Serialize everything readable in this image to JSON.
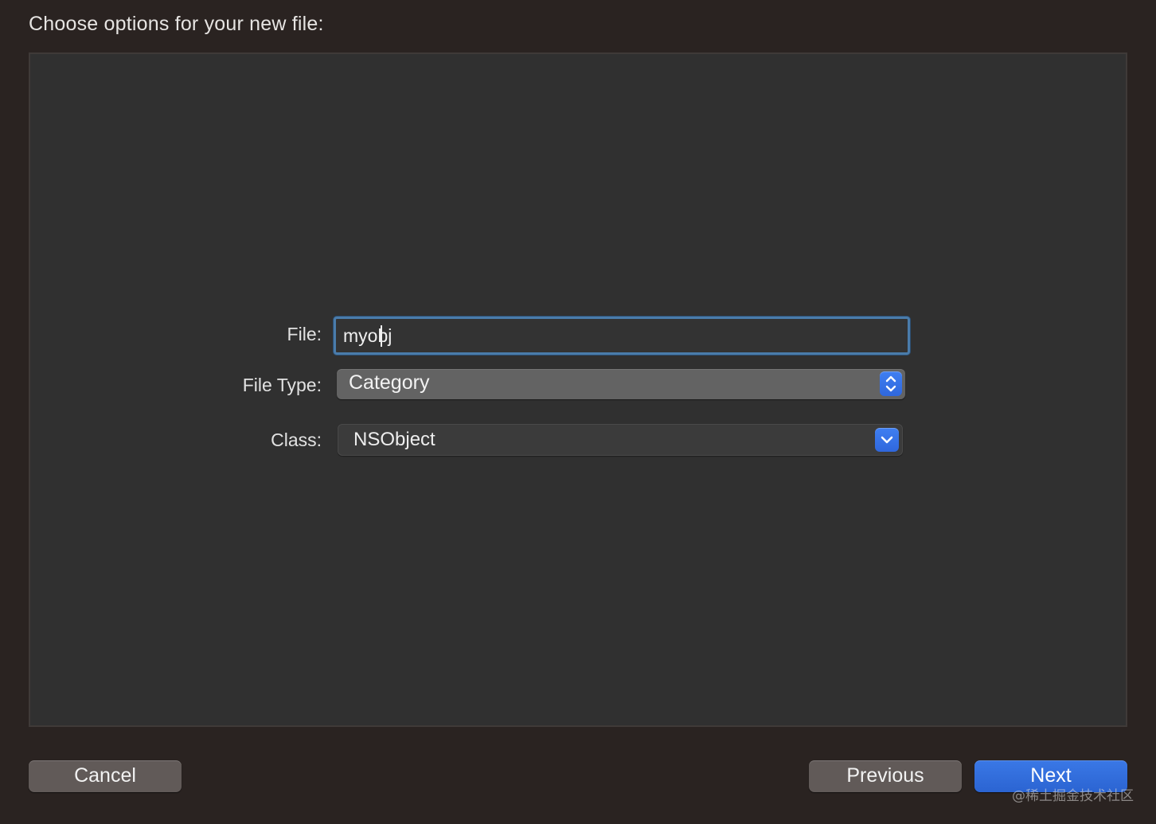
{
  "dialog": {
    "title": "Choose options for your new file:"
  },
  "form": {
    "file_label": "File:",
    "file_value": "myobj",
    "file_type_label": "File Type:",
    "file_type_value": "Category",
    "class_label": "Class:",
    "class_value": "NSObject"
  },
  "buttons": {
    "cancel": "Cancel",
    "previous": "Previous",
    "next": "Next"
  },
  "watermark": "@稀土掘金技术社区",
  "colors": {
    "accent": "#3a78e6",
    "focus_ring": "#4a7cab",
    "background": "#2a2321",
    "panel": "#303030"
  },
  "icons": {
    "file_type_popup": "up-down-chevron-icon",
    "class_combo": "chevron-down-icon"
  }
}
